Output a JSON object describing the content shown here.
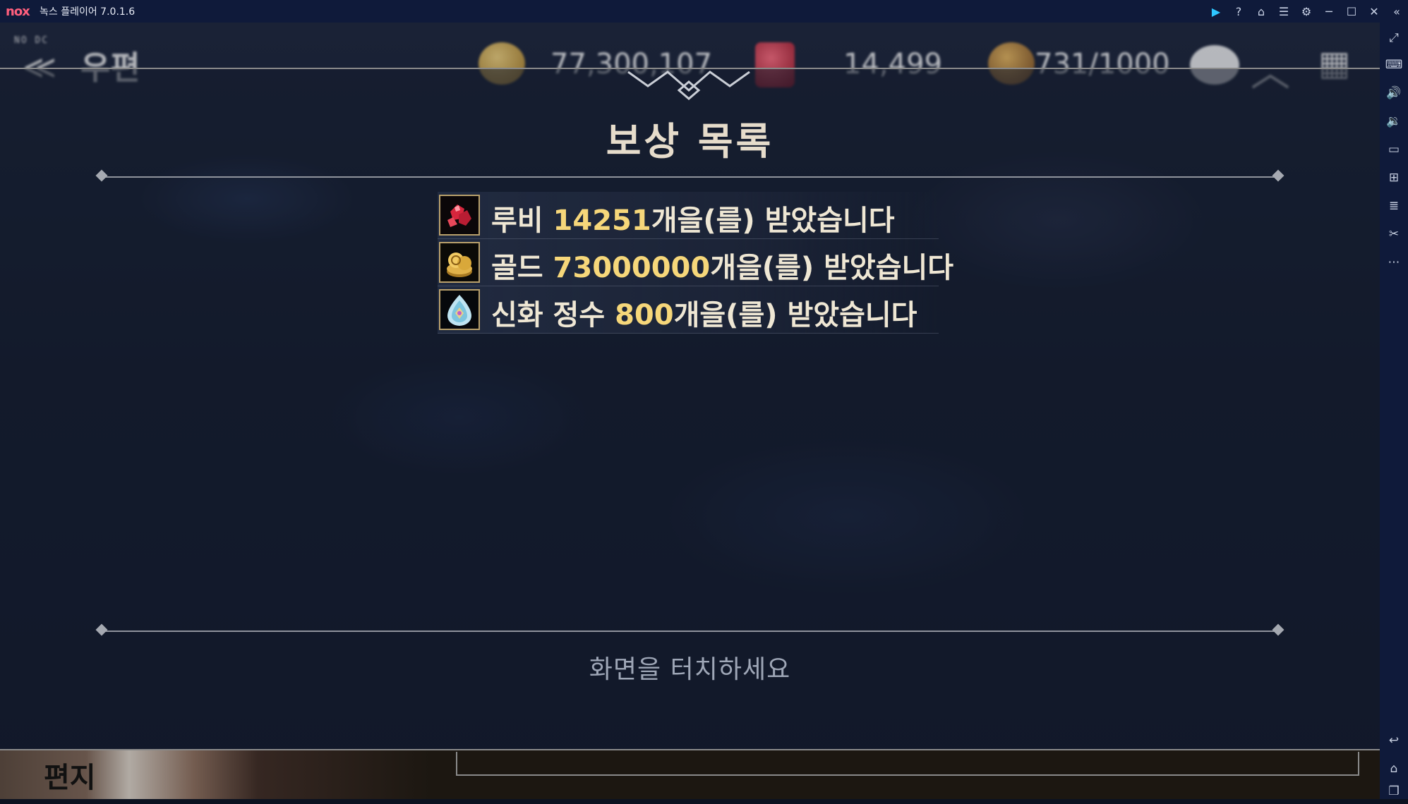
{
  "window": {
    "logo": "nox",
    "title": "녹스 플레이어 7.0.1.6",
    "controls": [
      {
        "name": "play-icon",
        "glyph": "▶"
      },
      {
        "name": "help-icon",
        "glyph": "?"
      },
      {
        "name": "theme-icon",
        "glyph": "⌂"
      },
      {
        "name": "menu-icon",
        "glyph": "☰"
      },
      {
        "name": "settings-icon",
        "glyph": "⚙"
      },
      {
        "name": "minimize-icon",
        "glyph": "─"
      },
      {
        "name": "maximize-icon",
        "glyph": "☐"
      },
      {
        "name": "close-icon",
        "glyph": "✕"
      },
      {
        "name": "collapse-sidebar-icon",
        "glyph": "«"
      }
    ]
  },
  "sidebar": {
    "buttons": [
      {
        "name": "fullscreen-icon",
        "glyph": "⤢"
      },
      {
        "name": "keyboard-icon",
        "glyph": "⌨"
      },
      {
        "name": "volume-up-icon",
        "glyph": "🔊"
      },
      {
        "name": "volume-down-icon",
        "glyph": "🔉"
      },
      {
        "name": "screen-icon",
        "glyph": "▭"
      },
      {
        "name": "apk-install-icon",
        "glyph": "⊞"
      },
      {
        "name": "multi-instance-icon",
        "glyph": "≣"
      },
      {
        "name": "scissors-icon",
        "glyph": "✂"
      },
      {
        "name": "more-icon",
        "glyph": "⋯"
      },
      {
        "name": "back-icon",
        "glyph": "↩"
      },
      {
        "name": "home-icon",
        "glyph": "⌂"
      },
      {
        "name": "recent-apps-icon",
        "glyph": "❐"
      }
    ]
  },
  "background": {
    "nodc": "NO DC",
    "title": "우편",
    "gold": "77,300,107",
    "ruby": "14,499",
    "medal": "731/1000",
    "bottom_label": "편지"
  },
  "popup": {
    "title": "보상 목록",
    "rewards": [
      {
        "item": "루비",
        "count": "14251",
        "suffix": "개을(를) 받았습니다",
        "icon": "ruby-icon"
      },
      {
        "item": "골드",
        "count": "73000000",
        "suffix": "개을(를) 받았습니다",
        "icon": "gold-coins-icon"
      },
      {
        "item": "신화 정수",
        "count": "800",
        "suffix": "개을(를) 받았습니다",
        "icon": "myth-essence-icon"
      }
    ],
    "touch_prompt": "화면을 터치하세요"
  }
}
